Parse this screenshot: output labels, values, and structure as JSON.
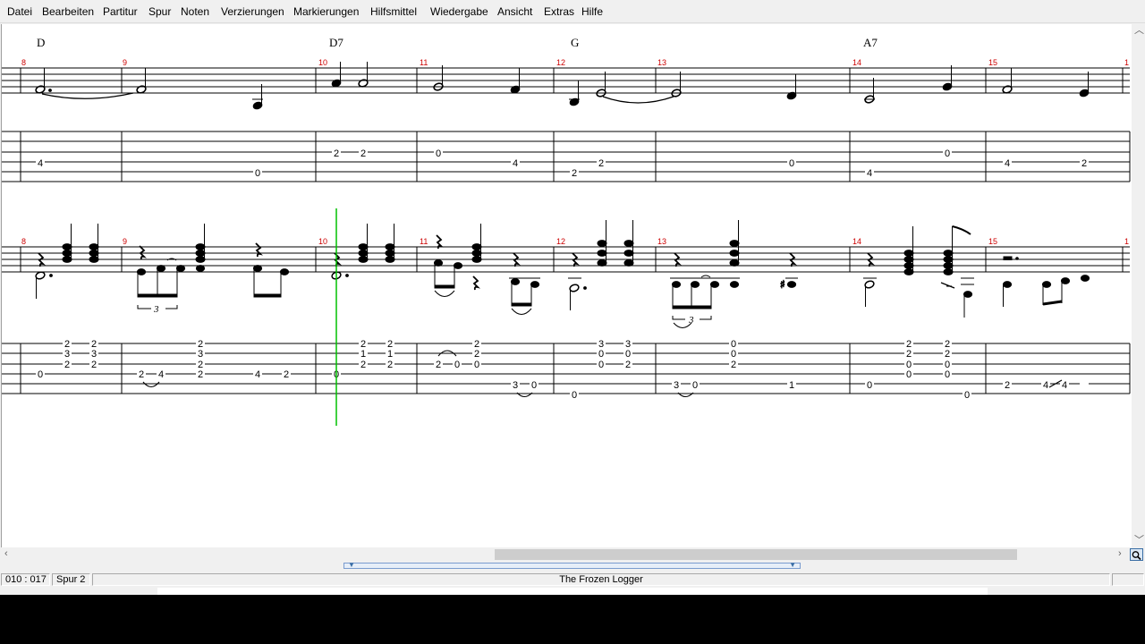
{
  "menu": [
    "Datei",
    "Bearbeiten",
    "Partitur",
    "Spur",
    "Noten",
    "Verzierungen",
    "Markierungen",
    "Hilfsmittel",
    "Wiedergabe",
    "Ansicht",
    "Extras",
    "Hilfe"
  ],
  "chords": [
    {
      "name": "D"
    },
    {
      "name": "D7"
    },
    {
      "name": "G"
    },
    {
      "name": "A7"
    }
  ],
  "measures": [
    "8",
    "9",
    "10",
    "11",
    "12",
    "13",
    "14",
    "15",
    "1"
  ],
  "tab1": {
    "frets": [
      "4",
      "0",
      "2",
      "2",
      "0",
      "4",
      "2",
      "2",
      "0",
      "4",
      "0",
      "4",
      "2"
    ]
  },
  "tab2": {
    "frets": [
      "2",
      "3",
      "2",
      "0",
      "2",
      "3",
      "2",
      "2",
      "4",
      "2",
      "3",
      "2",
      "2",
      "4",
      "2",
      "0",
      "2",
      "1",
      "2",
      "2",
      "1",
      "2",
      "2",
      "0",
      "2",
      "2",
      "0",
      "3",
      "0",
      "0",
      "3",
      "0",
      "0",
      "3",
      "0",
      "2",
      "3",
      "0",
      "0",
      "0",
      "2",
      "1",
      "0",
      "2",
      "2",
      "0",
      "0",
      "2",
      "2",
      "0",
      "0",
      "0",
      "2",
      "4",
      "4"
    ],
    "triplet": "3"
  },
  "status": {
    "position": "010 : 017",
    "track": "Spur 2",
    "title": "The Frozen Logger"
  },
  "colors": {
    "measure_number": "#cc0000",
    "cursor": "#00c000",
    "staff_line": "#000000"
  }
}
